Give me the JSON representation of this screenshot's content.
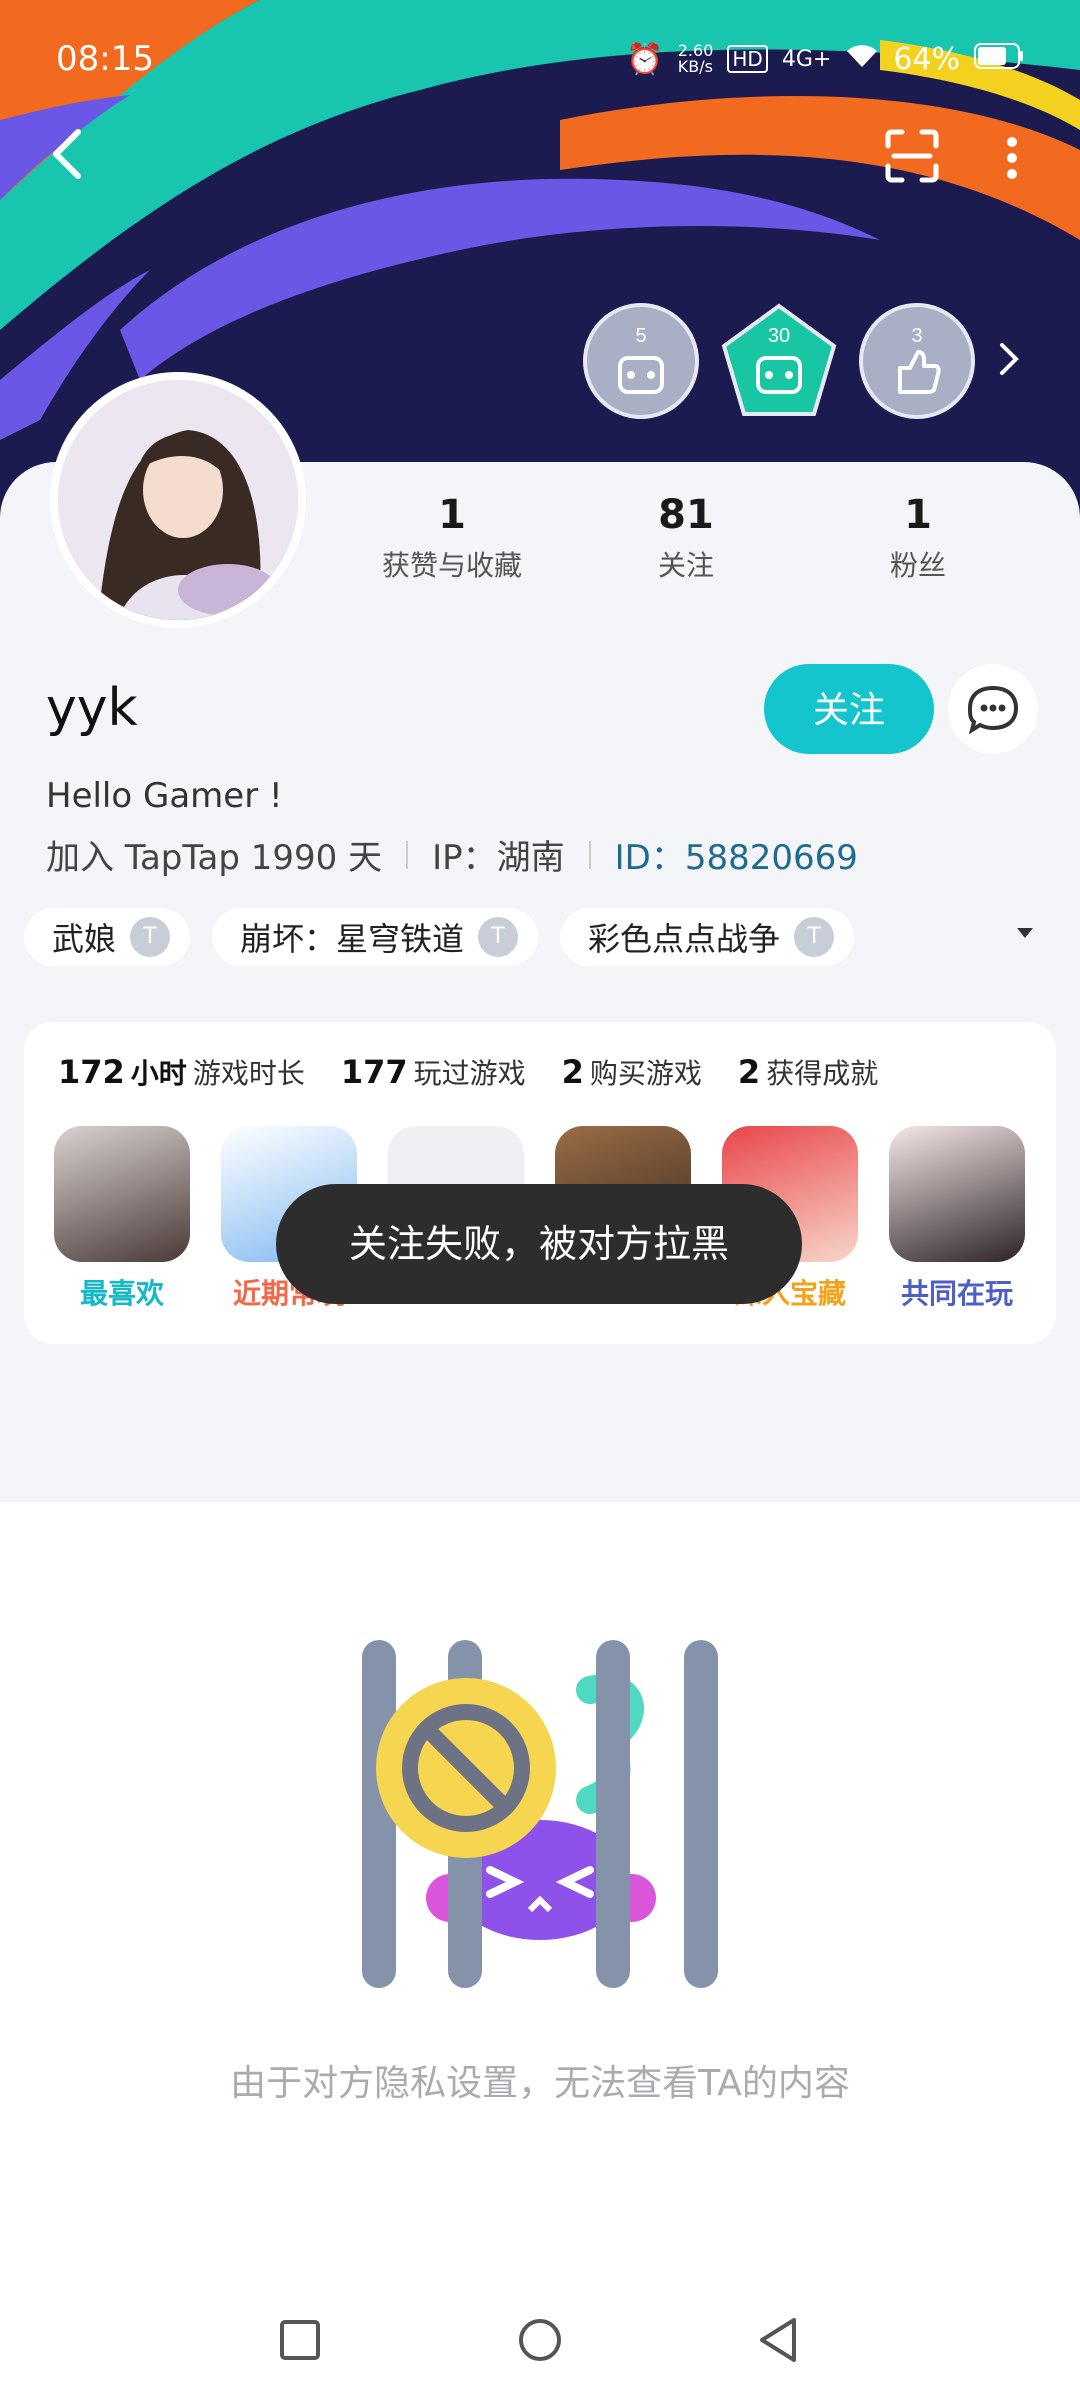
{
  "status": {
    "time": "08:15",
    "net_speed": "2.60\nKB/s",
    "hd": "HD",
    "signal": "4G+",
    "battery": "64%"
  },
  "badges": [
    {
      "number": "5",
      "name": "badge-5"
    },
    {
      "number": "30",
      "name": "badge-30"
    },
    {
      "number": "3",
      "name": "badge-3"
    }
  ],
  "stats": [
    {
      "value": "1",
      "label": "获赞与收藏"
    },
    {
      "value": "81",
      "label": "关注"
    },
    {
      "value": "1",
      "label": "粉丝"
    }
  ],
  "profile": {
    "name": "yyk",
    "follow_label": "关注",
    "bio": "Hello Gamer !",
    "joined": "加入 TapTap 1990 天",
    "ip": "IP：湖南",
    "id": "ID：58820669"
  },
  "tags": [
    "武娘",
    "崩坏：星穹铁道",
    "彩色点点战争"
  ],
  "game_stats": [
    {
      "value": "172",
      "unit": "小时",
      "label": "游戏时长"
    },
    {
      "value": "177",
      "label": "玩过游戏"
    },
    {
      "value": "2",
      "label": "购买游戏"
    },
    {
      "value": "2",
      "label": "获得成就"
    }
  ],
  "games": [
    {
      "label": "最喜欢",
      "color": "#13b9c4"
    },
    {
      "label": "近期常玩",
      "color": "#f06a4a"
    },
    {
      "label": "",
      "color": "#c7c9ce"
    },
    {
      "label": "",
      "color": "#1aa9d6"
    },
    {
      "label": "深入宝藏",
      "color": "#f3a31b"
    },
    {
      "label": "共同在玩",
      "color": "#4d5fc7"
    }
  ],
  "toast": "关注失败，被对方拉黑",
  "empty_message": "由于对方隐私设置，无法查看TA的内容",
  "colors": {
    "accent": "#15c5ce",
    "card_bg": "#f3f5f8",
    "hero_bg": "#1c1b4f"
  }
}
